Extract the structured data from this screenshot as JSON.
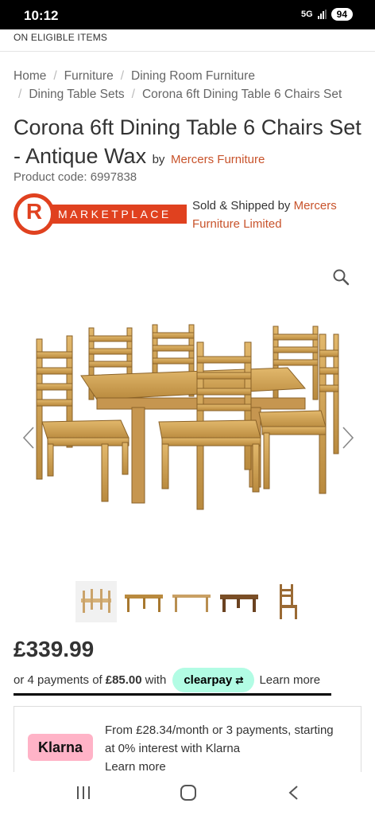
{
  "status": {
    "time": "10:12",
    "network": "5G",
    "battery": "94"
  },
  "promo_text": "ON ELIGIBLE ITEMS",
  "breadcrumb": [
    "Home",
    "Furniture",
    "Dining Room Furniture",
    "Dining Table Sets",
    "Corona 6ft Dining Table 6 Chairs Set"
  ],
  "product": {
    "title": "Corona 6ft Dining Table 6 Chairs Set - Antique Wax",
    "by_label": "by",
    "brand": "Mercers Furniture",
    "code_label": "Product code:",
    "code": "6997838"
  },
  "marketplace": {
    "logo_letter": "R",
    "logo_text": "MARKETPLACE"
  },
  "sold": {
    "prefix": "Sold & Shipped by",
    "seller": "Mercers Furniture Limited"
  },
  "price": "£339.99",
  "installments": {
    "prefix": "or 4 payments of",
    "amount": "£85.00",
    "with": "with",
    "provider": "clearpay",
    "learn_more": "Learn more"
  },
  "klarna": {
    "badge": "Klarna",
    "text": "From £28.34/month or 3 payments, starting at 0% interest with Klarna",
    "learn_more": "Learn more"
  },
  "colors": {
    "accent": "#c8532b",
    "marketplace_red": "#e0411f",
    "clearpay": "#b2fce4",
    "klarna": "#ffb3c7"
  }
}
